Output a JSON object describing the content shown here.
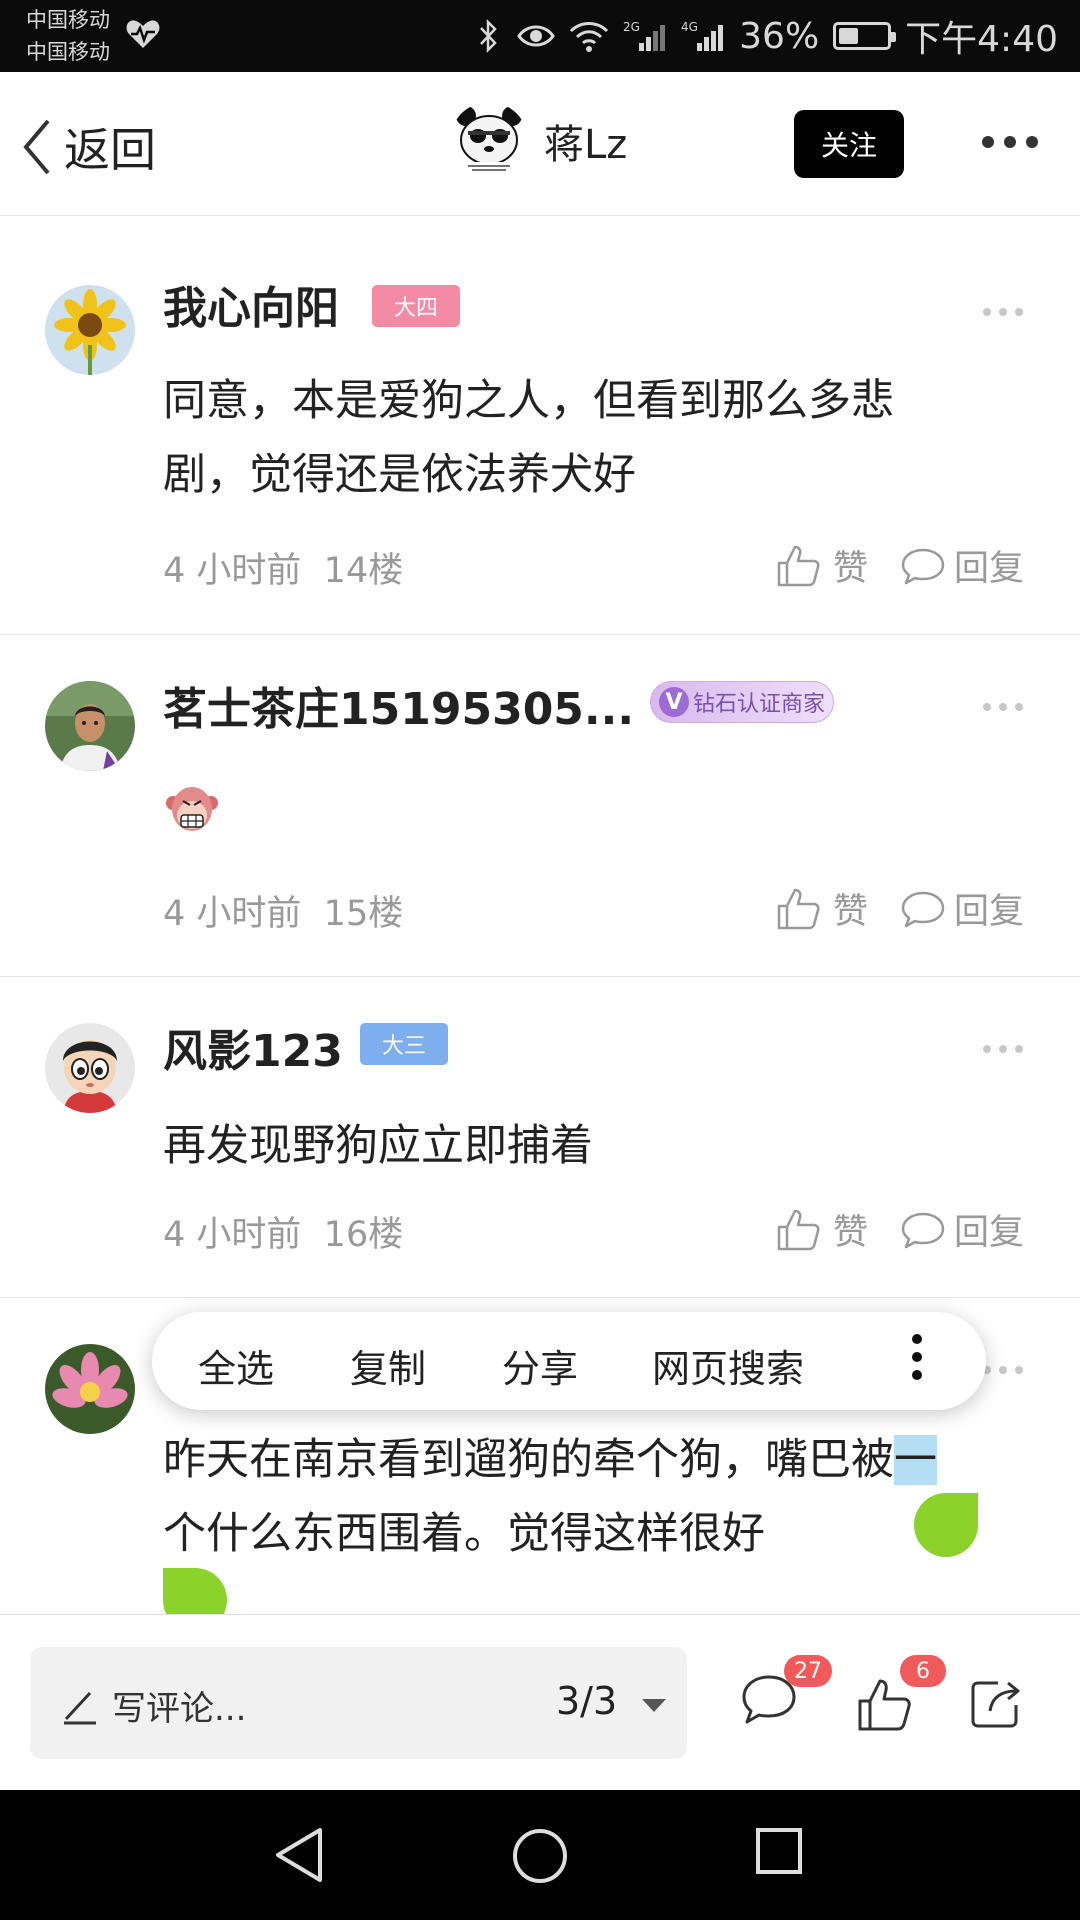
{
  "status_bar": {
    "carrier1": "中国移动",
    "carrier2": "中国移动",
    "battery_percent": "36%",
    "battery_level": 0.36,
    "time": "下午4:40"
  },
  "nav": {
    "back_label": "返回",
    "author_name": "蒋Lz",
    "follow_label": "关注"
  },
  "comments": [
    {
      "username": "我心向阳",
      "badge": "大四",
      "text_line1": "同意，本是爱狗之人，但看到那么多悲",
      "text_line2": "剧，觉得还是依法养犬好",
      "time": "4 小时前",
      "floor": "14楼",
      "like_label": "赞",
      "reply_label": "回复"
    },
    {
      "username": "茗士茶庄15195305...",
      "badge_icon": "V",
      "badge": "钻石认证商家",
      "emoji": "monkey-emoji",
      "time": "4 小时前",
      "floor": "15楼",
      "like_label": "赞",
      "reply_label": "回复"
    },
    {
      "username": "风影123",
      "badge": "大三",
      "text_line1": "再发现野狗应立即捕着",
      "time": "4 小时前",
      "floor": "16楼",
      "like_label": "赞",
      "reply_label": "回复"
    },
    {
      "text_line1_before": "昨天在南京看到遛狗的牵个狗，嘴巴被",
      "text_line1_selected": "一",
      "text_line2": "个什么东西围着。觉得这样很好"
    }
  ],
  "selection_menu": {
    "select_all": "全选",
    "copy": "复制",
    "share": "分享",
    "web_search": "网页搜索"
  },
  "bottom_bar": {
    "comment_placeholder": "写评论...",
    "page_indicator": "3/3",
    "comment_count": "27",
    "like_count": "6"
  },
  "colors": {
    "badge_pink": "#f48aa4",
    "badge_blue": "#7daeee",
    "selection_handle": "#8bd22a",
    "selection_highlight": "#b3def4",
    "count_badge": "#f05a5a"
  }
}
